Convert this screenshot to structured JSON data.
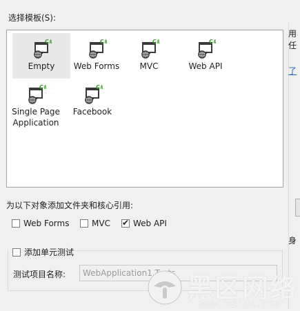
{
  "dialog": {
    "select_template_label": "选择模板(S):",
    "templates": [
      {
        "label": "Empty",
        "selected": true,
        "icon": "csharp-web-project-icon"
      },
      {
        "label": "Web Forms",
        "selected": false,
        "icon": "csharp-web-project-icon"
      },
      {
        "label": "MVC",
        "selected": false,
        "icon": "csharp-web-project-icon"
      },
      {
        "label": "Web API",
        "selected": false,
        "icon": "csharp-web-project-icon"
      },
      {
        "label": "Single Page\nApplication",
        "selected": false,
        "icon": "csharp-web-project-icon"
      },
      {
        "label": "Facebook",
        "selected": false,
        "icon": "csharp-web-project-icon"
      }
    ],
    "references_label": "为以下对象添加文件夹和核心引用:",
    "references": [
      {
        "label": "Web Forms",
        "checked": false
      },
      {
        "label": "MVC",
        "checked": false
      },
      {
        "label": "Web API",
        "checked": true
      }
    ],
    "unit_test": {
      "label": "添加单元测试",
      "checked": false,
      "project_name_label": "测试项目名称:",
      "project_name_value": "WebApplication1.Tests"
    }
  },
  "right_panel": {
    "line1": "用",
    "line2": "任",
    "link_fragment": "了",
    "bottom_fragment": "身"
  },
  "watermark": {
    "title": "黑区网络",
    "url": "www.heiqu.com"
  },
  "colors": {
    "csharp_green": "#3c9a2c",
    "icon_dark": "#3a3a3a",
    "selection_bg": "#e8e8e8",
    "link_blue": "#1a5fb4"
  }
}
